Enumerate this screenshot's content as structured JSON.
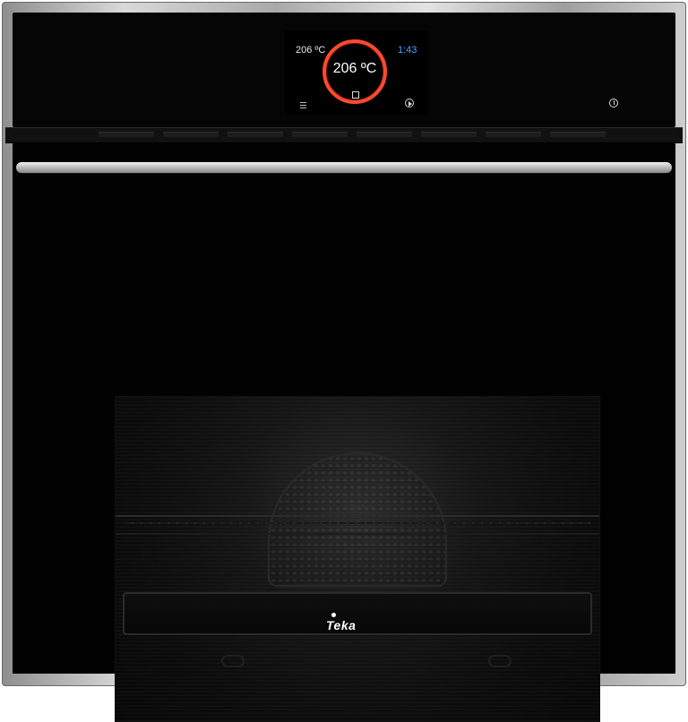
{
  "display": {
    "temp_small": "206 ºC",
    "temp_big": "206 ºC",
    "time": "1:43"
  },
  "icons": {
    "menu": "menu-icon",
    "mode": "oven-mode-icon",
    "play": "play-icon",
    "power": "power-icon"
  },
  "brand": {
    "logo_text": "Teka"
  },
  "colors": {
    "temperature_ring": "#ff4a2c",
    "time_text": "#48a7ff"
  }
}
